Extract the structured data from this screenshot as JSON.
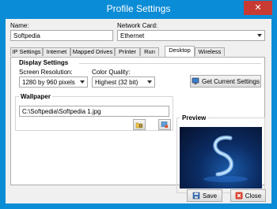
{
  "window": {
    "title": "Profile Settings",
    "close_glyph": "✕"
  },
  "form": {
    "name_label": "Name:",
    "name_value": "Softpedia",
    "network_label": "Network Card:",
    "network_value": "Ethernet"
  },
  "tabs": [
    {
      "label": "IP Settings",
      "active": false
    },
    {
      "label": "Internet",
      "active": false
    },
    {
      "label": "Mapped Drives",
      "active": false
    },
    {
      "label": "Printer",
      "active": false
    },
    {
      "label": "Run",
      "active": false
    },
    {
      "label": "Desktop",
      "active": true
    },
    {
      "label": "Wireless",
      "active": false
    }
  ],
  "display": {
    "group_title": "Display Settings",
    "resolution_label": "Screen Resolution:",
    "resolution_value": "1280 by 960 pixels",
    "color_label": "Color Quality:",
    "color_value": "Highest (32 bit)",
    "get_current_label": "Get Current Settings"
  },
  "wallpaper": {
    "group_title": "Wallpaper",
    "path_value": "C:\\Softpedia\\Softpedia 1.jpg"
  },
  "preview": {
    "group_title": "Preview"
  },
  "footer": {
    "save_label": "Save",
    "close_label": "Close"
  },
  "colors": {
    "titlebar": "#0b8cd6",
    "close_button": "#c83a32"
  }
}
